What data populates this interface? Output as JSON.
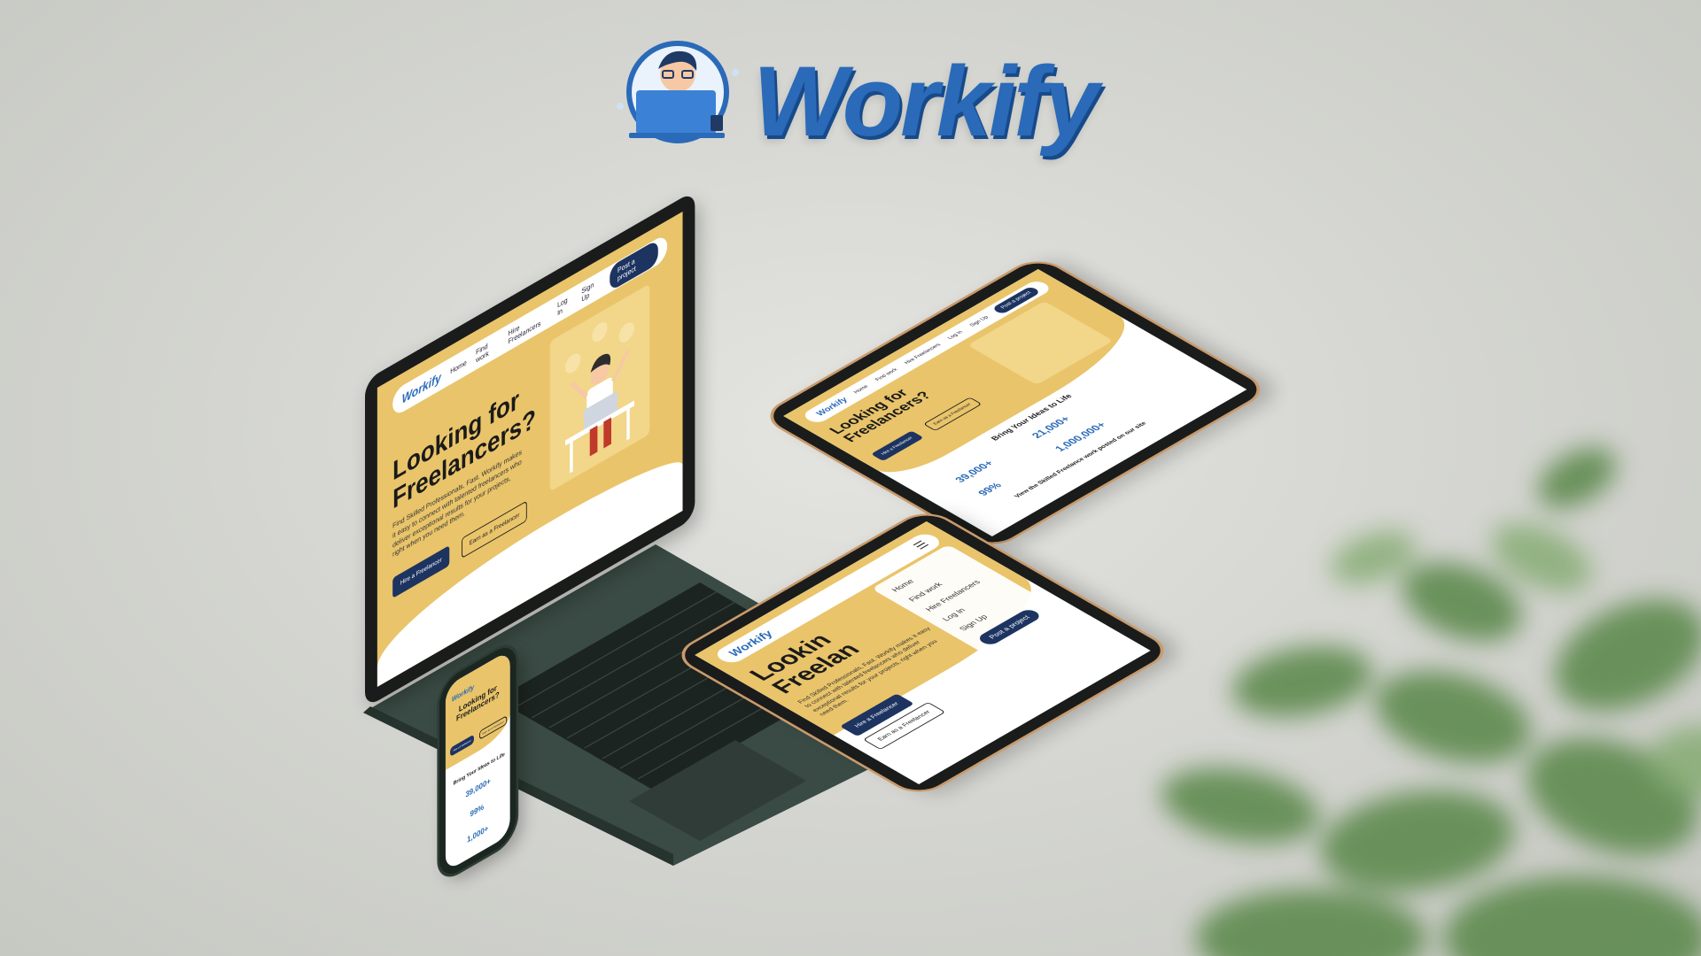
{
  "brand": {
    "logo_text": "Workify",
    "logo_colors": {
      "primary": "#2a6ab8",
      "shadow": "#174a8a"
    },
    "logo_icon": "person-at-laptop-icon"
  },
  "colors": {
    "site_yellow": "#e9c46a",
    "site_navy": "#1d3461",
    "accent_blue": "#2a6ab8",
    "device_bezel": "#1a1c1b",
    "tablet_gold": "#c99a6b"
  },
  "laptop": {
    "nav": {
      "brand": "Workify",
      "links": [
        "Home",
        "Find work",
        "Hire Freelancers",
        "Log In",
        "Sign Up"
      ],
      "cta": "Post a project"
    },
    "hero": {
      "title_line1": "Looking for",
      "title_line2": "Freelancers?",
      "description": "Find Skilled Professionals, Fast. Workify makes it easy to connect with talented freelancers who deliver exceptional results for your projects, right when you need them.",
      "primary_button": "Hire a Freelancer",
      "secondary_button": "Earn as a Freelancer"
    }
  },
  "tablet_back": {
    "nav": {
      "brand": "Workify",
      "links": [
        "Home",
        "Find work",
        "Hire Freelancers",
        "Log In",
        "Sign Up"
      ],
      "cta": "Post a project"
    },
    "hero": {
      "title_line1": "Looking for",
      "title_line2": "Freelancers?",
      "primary_button": "Hire a Freelancer",
      "secondary_button": "Earn as a Freelancer"
    },
    "section_title": "Bring Your Ideas to Life",
    "stats": [
      {
        "value": "39,000+"
      },
      {
        "value": "21,000+"
      },
      {
        "value": "99%"
      },
      {
        "value": "1,000,000+"
      }
    ],
    "sub_title": "View the Skilled Freelance work posted on our site"
  },
  "tablet_front": {
    "brand": "Workify",
    "hero": {
      "title_line1": "Lookin",
      "title_line2": "Freelan",
      "description": "Find Skilled Professionals, Fast. Workify makes it easy to connect with talented freelancers who deliver exceptional results for your projects, right when you need them.",
      "primary_button": "Hire a Freelancer",
      "secondary_button": "Earn as a Freelancer"
    },
    "menu": {
      "items": [
        "Home",
        "Find work",
        "Hire Freelancers",
        "Log In",
        "Sign Up"
      ],
      "cta": "Post a project"
    }
  },
  "phone": {
    "brand": "Workify",
    "hero": {
      "title_line1": "Looking for",
      "title_line2": "Freelancers?",
      "primary_button": "Hire a Freelancer",
      "secondary_button": "Earn as a Freelancer"
    },
    "section_title": "Bring Your Ideas to Life",
    "stats": [
      {
        "value": "39,000+"
      },
      {
        "value": "99%"
      },
      {
        "value": "1,000+"
      }
    ]
  }
}
